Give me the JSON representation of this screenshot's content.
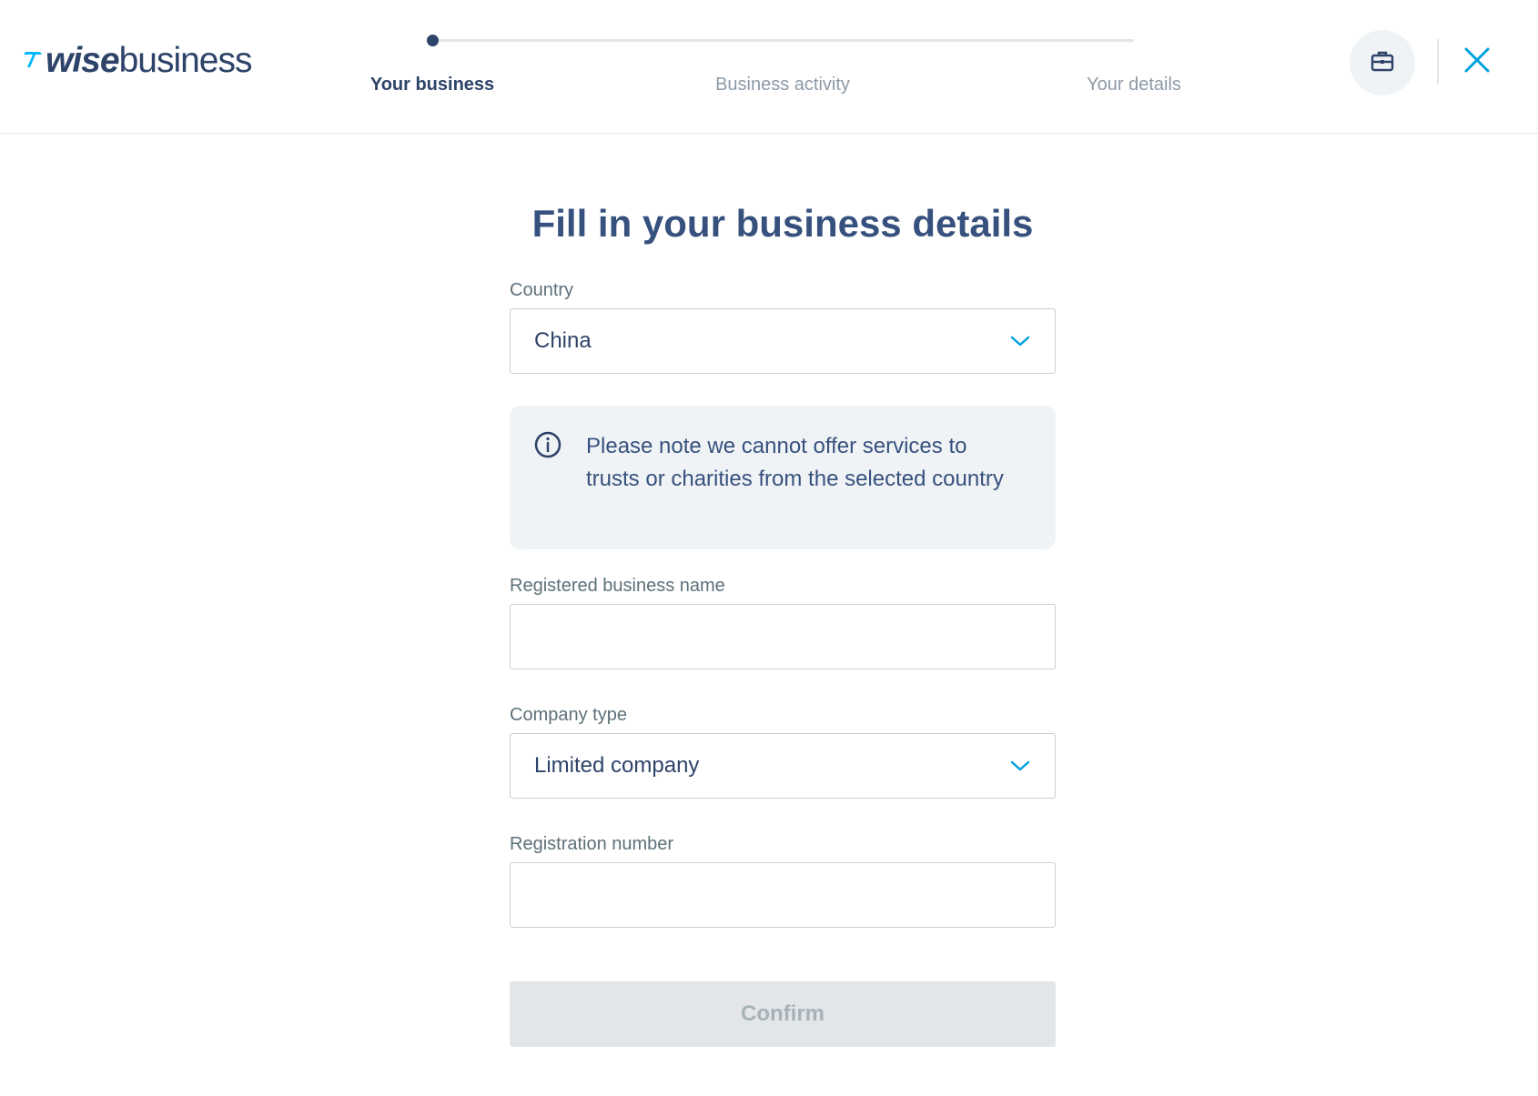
{
  "brand": {
    "flag": "⁷⁄",
    "wise": "wise",
    "business": "business"
  },
  "stepper": {
    "steps": [
      {
        "label": "Your business",
        "state": "active"
      },
      {
        "label": "Business activity",
        "state": "inactive"
      },
      {
        "label": "Your details",
        "state": "inactive"
      }
    ]
  },
  "header": {
    "briefcase_icon": "briefcase-icon",
    "close_icon": "close-icon"
  },
  "page": {
    "title": "Fill in your business details"
  },
  "form": {
    "country": {
      "label": "Country",
      "value": "China"
    },
    "note": {
      "icon": "info-icon",
      "text": "Please note we cannot offer services to trusts or charities from the selected country"
    },
    "business_name": {
      "label": "Registered business name",
      "value": ""
    },
    "company_type": {
      "label": "Company type",
      "value": "Limited company"
    },
    "registration_number": {
      "label": "Registration number",
      "value": ""
    },
    "confirm_label": "Confirm"
  },
  "colors": {
    "primary_text": "#37517e",
    "accent": "#00b9ff",
    "label_text": "#5d7079",
    "note_bg": "#f0f3f6",
    "disabled_bg": "#e2e6e8",
    "disabled_text": "#a7b1b8"
  }
}
